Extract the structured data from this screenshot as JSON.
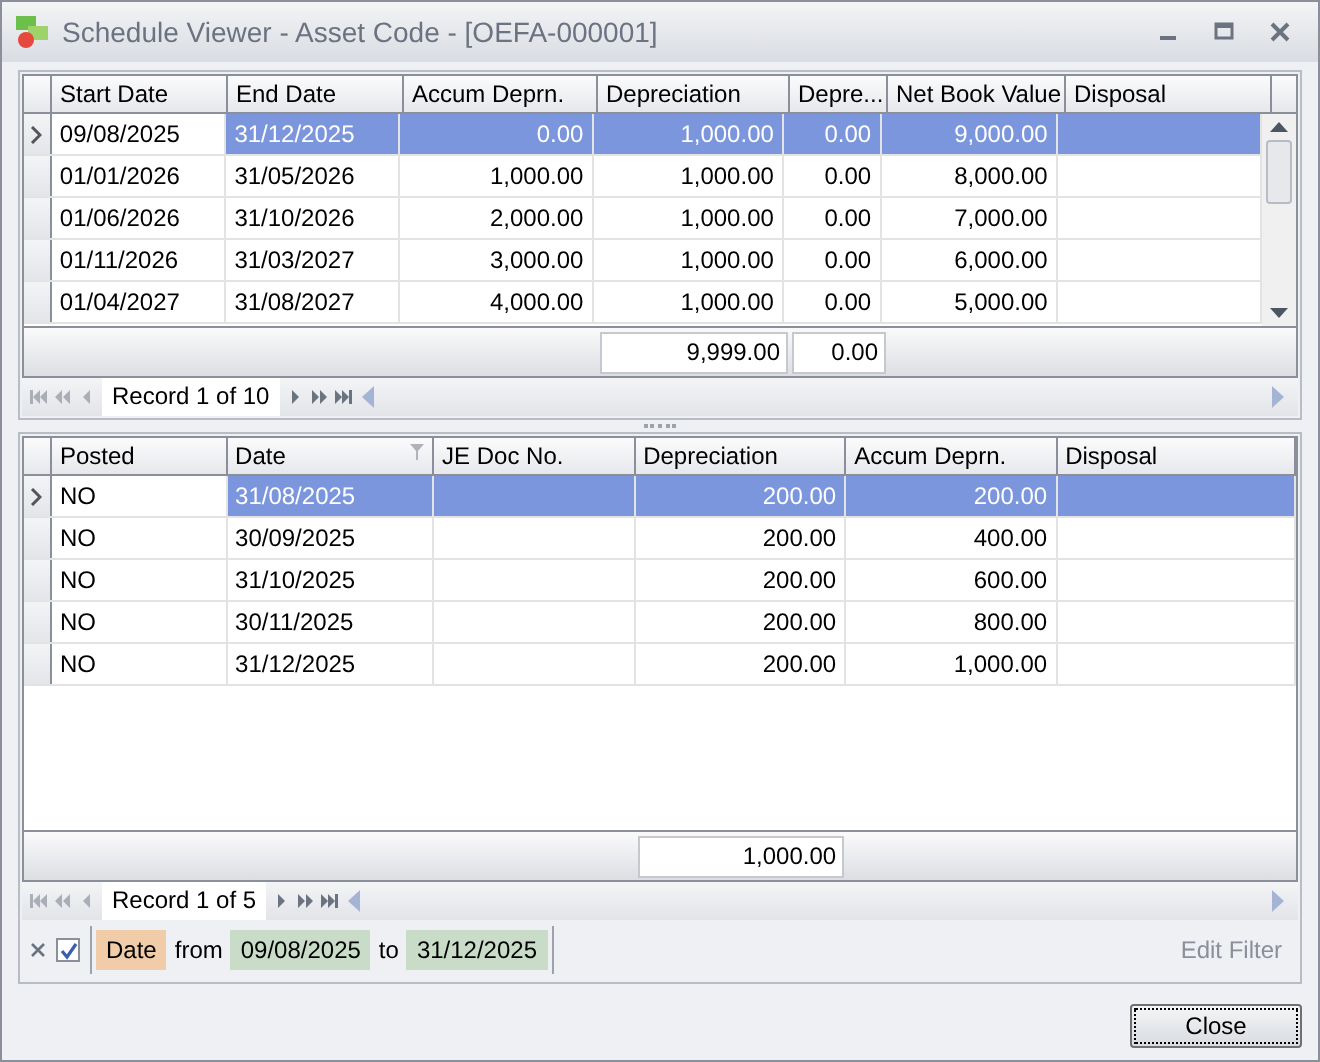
{
  "window": {
    "title": "Schedule Viewer - Asset Code - [OEFA-000001]"
  },
  "schedule_grid": {
    "columns": [
      {
        "label": "Start Date",
        "kind": "text",
        "focused": true
      },
      {
        "label": "End Date",
        "kind": "text",
        "focused": false
      },
      {
        "label": "Accum Deprn.",
        "kind": "number",
        "focused": false
      },
      {
        "label": "Depreciation",
        "kind": "number",
        "focused": false,
        "total": "9,999.00"
      },
      {
        "label": "Depre...",
        "kind": "number",
        "focused": false,
        "total": "0.00"
      },
      {
        "label": "Net Book Value",
        "kind": "number",
        "focused": false
      },
      {
        "label": "Disposal",
        "kind": "text",
        "focused": false
      }
    ],
    "rows": [
      {
        "selected": true,
        "cells": [
          "09/08/2025",
          "31/12/2025",
          "0.00",
          "1,000.00",
          "0.00",
          "9,000.00",
          ""
        ]
      },
      {
        "selected": false,
        "cells": [
          "01/01/2026",
          "31/05/2026",
          "1,000.00",
          "1,000.00",
          "0.00",
          "8,000.00",
          ""
        ]
      },
      {
        "selected": false,
        "cells": [
          "01/06/2026",
          "31/10/2026",
          "2,000.00",
          "1,000.00",
          "0.00",
          "7,000.00",
          ""
        ]
      },
      {
        "selected": false,
        "cells": [
          "01/11/2026",
          "31/03/2027",
          "3,000.00",
          "1,000.00",
          "0.00",
          "6,000.00",
          ""
        ]
      },
      {
        "selected": false,
        "cells": [
          "01/04/2027",
          "31/08/2027",
          "4,000.00",
          "1,000.00",
          "0.00",
          "5,000.00",
          ""
        ]
      }
    ],
    "navigator": "Record 1 of 10"
  },
  "detail_grid": {
    "columns": [
      {
        "label": "Posted",
        "kind": "text",
        "focused": true
      },
      {
        "label": "Date",
        "kind": "text",
        "focused": false,
        "filtered": true
      },
      {
        "label": "JE Doc No.",
        "kind": "text",
        "focused": false
      },
      {
        "label": "Depreciation",
        "kind": "number",
        "focused": false,
        "total": "1,000.00"
      },
      {
        "label": "Accum Deprn.",
        "kind": "number",
        "focused": false
      },
      {
        "label": "Disposal",
        "kind": "text",
        "focused": false
      }
    ],
    "rows": [
      {
        "selected": true,
        "cells": [
          "NO",
          "31/08/2025",
          "",
          "200.00",
          "200.00",
          ""
        ]
      },
      {
        "selected": false,
        "cells": [
          "NO",
          "30/09/2025",
          "",
          "200.00",
          "400.00",
          ""
        ]
      },
      {
        "selected": false,
        "cells": [
          "NO",
          "31/10/2025",
          "",
          "200.00",
          "600.00",
          ""
        ]
      },
      {
        "selected": false,
        "cells": [
          "NO",
          "30/11/2025",
          "",
          "200.00",
          "800.00",
          ""
        ]
      },
      {
        "selected": false,
        "cells": [
          "NO",
          "31/12/2025",
          "",
          "200.00",
          "1,000.00",
          ""
        ]
      }
    ],
    "navigator": "Record 1 of 5"
  },
  "filter": {
    "enabled": true,
    "field": "Date",
    "from_label": "from",
    "from": "09/08/2025",
    "to_label": "to",
    "to": "31/12/2025",
    "edit": "Edit Filter"
  },
  "buttons": [
    "Close"
  ]
}
